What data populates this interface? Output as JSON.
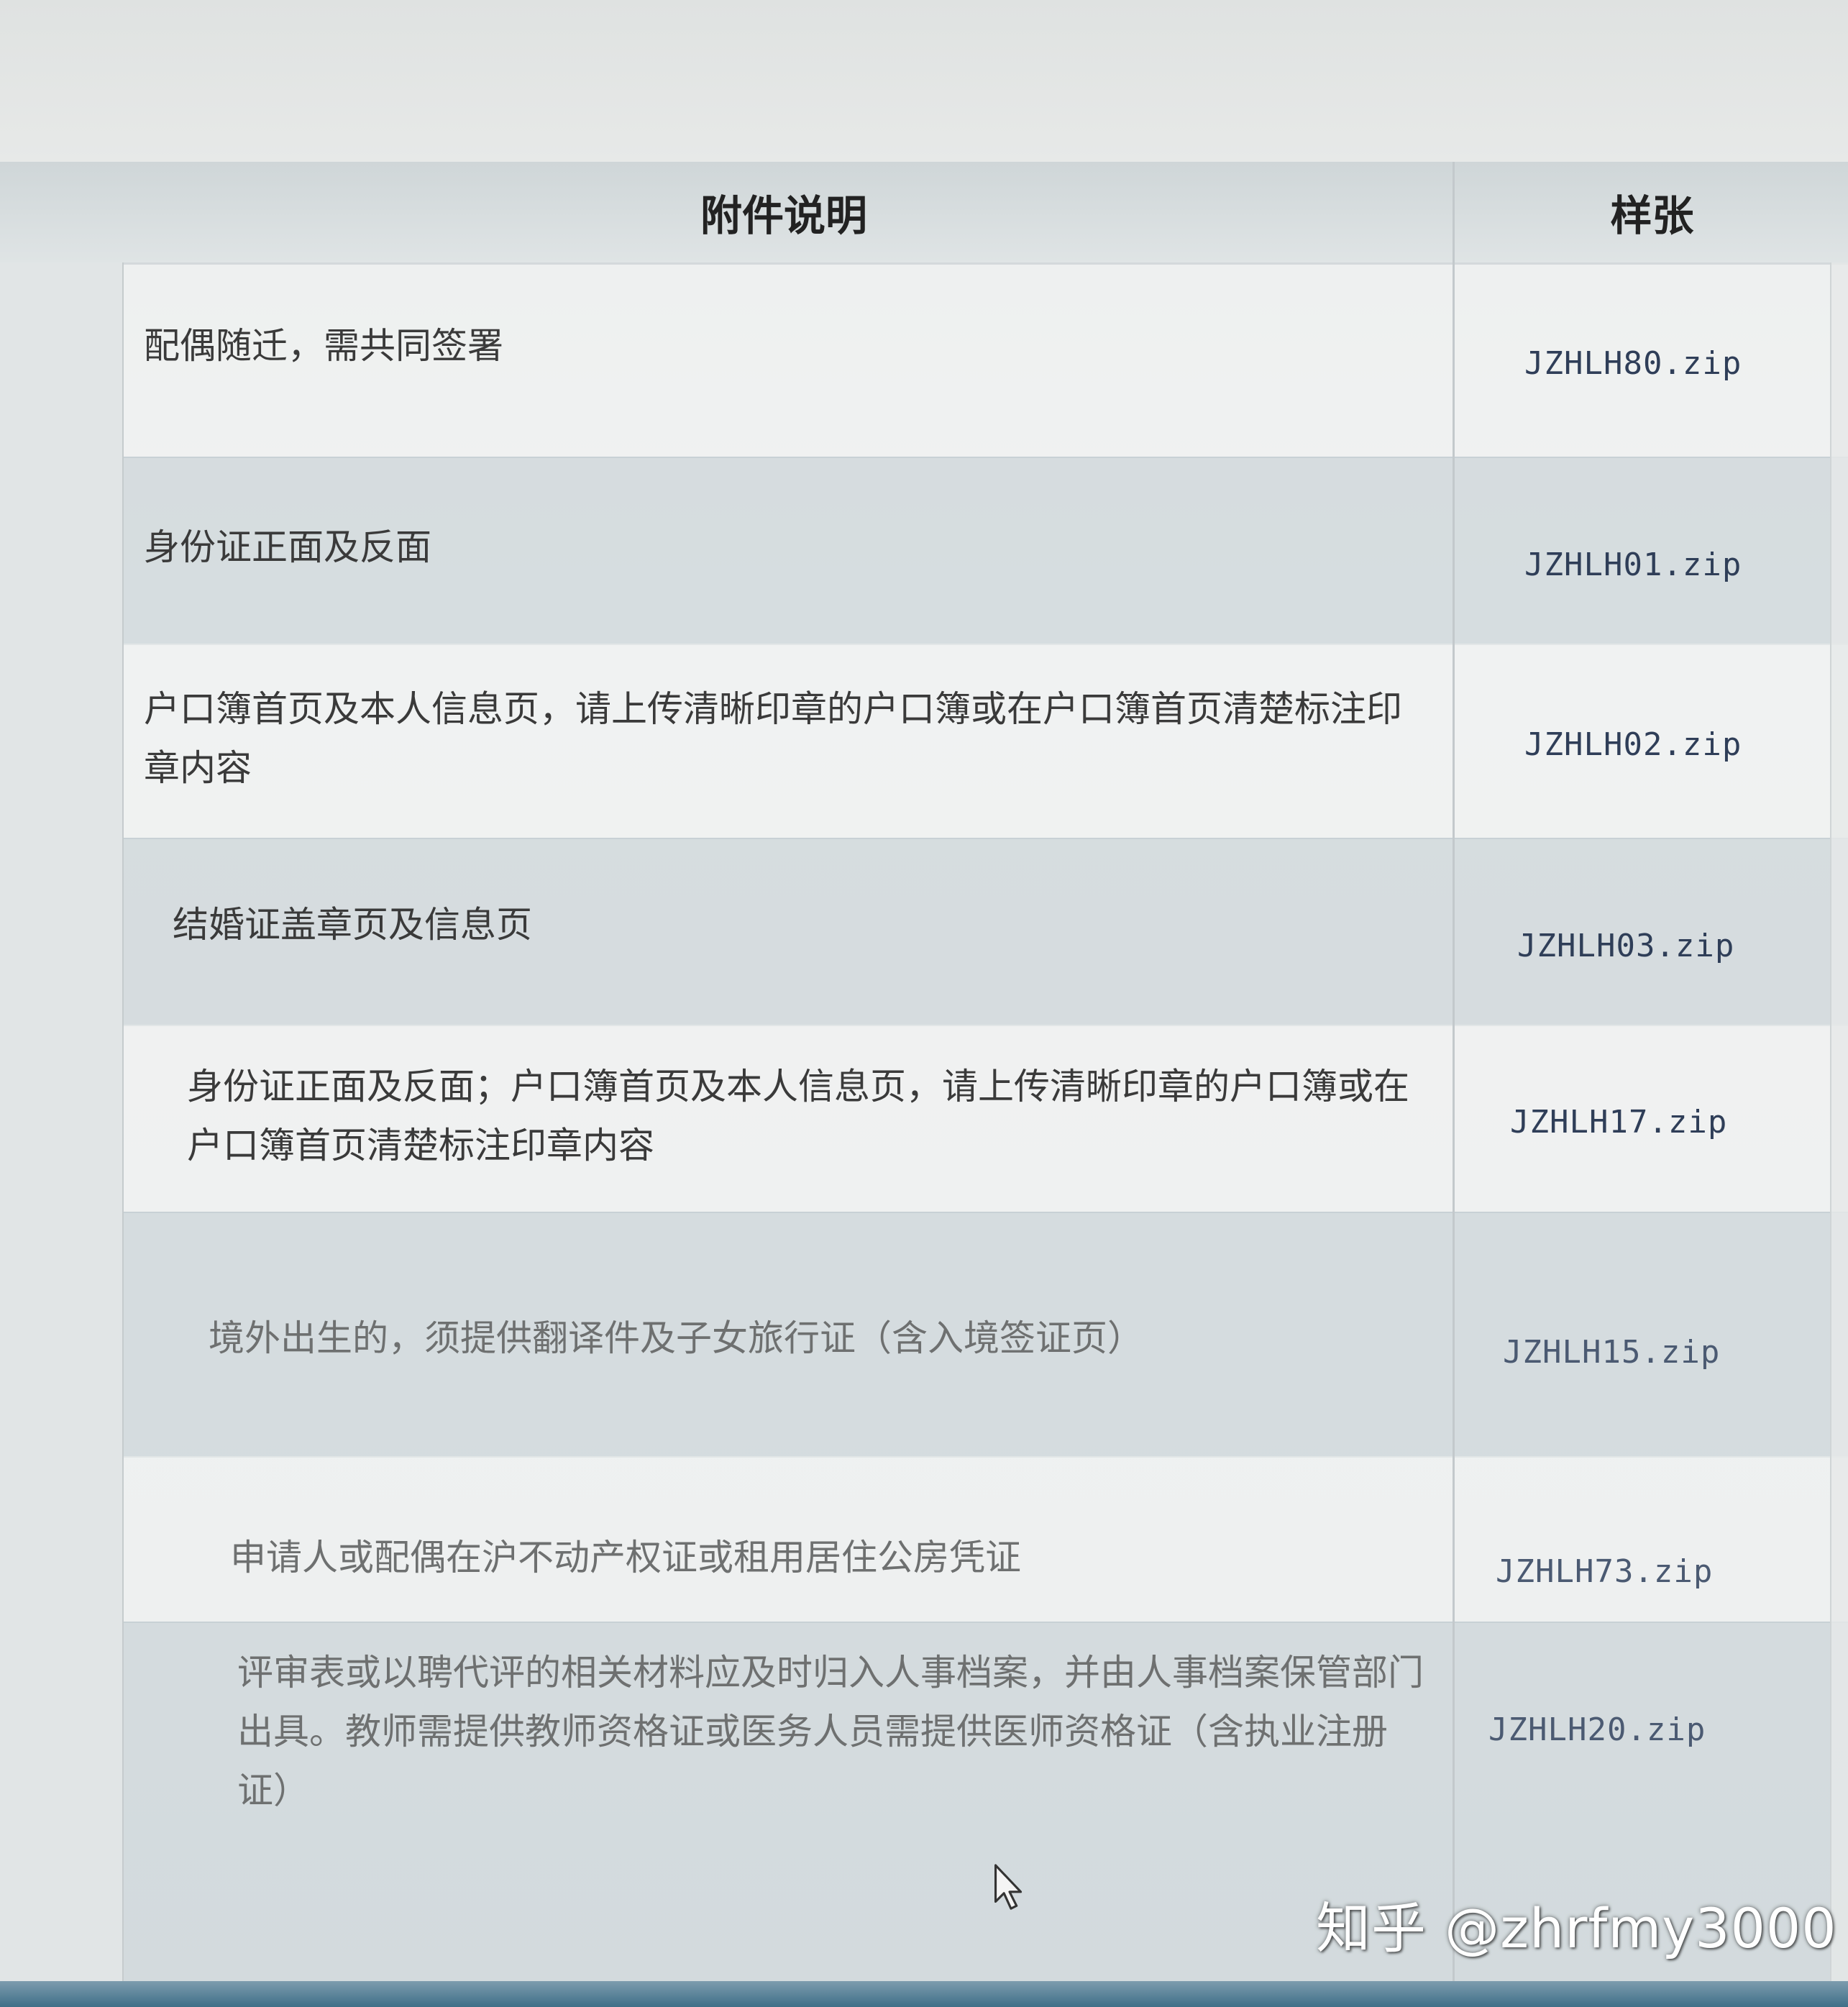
{
  "table": {
    "header": {
      "description": "附件说明",
      "sample": "样张"
    },
    "rows": [
      {
        "description": "配偶随迁，需共同签署",
        "sample": "JZHLH80.zip"
      },
      {
        "description": "身份证正面及反面",
        "sample": "JZHLH01.zip"
      },
      {
        "description": "户口簿首页及本人信息页，请上传清晰印章的户口簿或在户口簿首页清楚标注印章内容",
        "sample": "JZHLH02.zip"
      },
      {
        "description": "结婚证盖章页及信息页",
        "sample": "JZHLH03.zip"
      },
      {
        "description": "身份证正面及反面；户口簿首页及本人信息页，请上传清晰印章的户口簿或在户口簿首页清楚标注印章内容",
        "sample": "JZHLH17.zip"
      },
      {
        "description": "境外出生的，须提供翻译件及子女旅行证（含入境签证页）",
        "sample": "JZHLH15.zip"
      },
      {
        "description": "申请人或配偶在沪不动产权证或租用居住公房凭证",
        "sample": "JZHLH73.zip"
      },
      {
        "description": "评审表或以聘代评的相关材料应及时归入人事档案，并由人事档案保管部门出具。教师需提供教师资格证或医务人员需提供医师资格证（含执业注册证）",
        "sample": "JZHLH20.zip"
      }
    ]
  },
  "watermark": "知乎 @zhrfmy3000",
  "icons": {
    "cursor": "mouse-pointer-icon"
  },
  "colors": {
    "link": "#2f3e58",
    "header_bg": "#d3dadc",
    "bottom_bar": "#3f6f88"
  }
}
